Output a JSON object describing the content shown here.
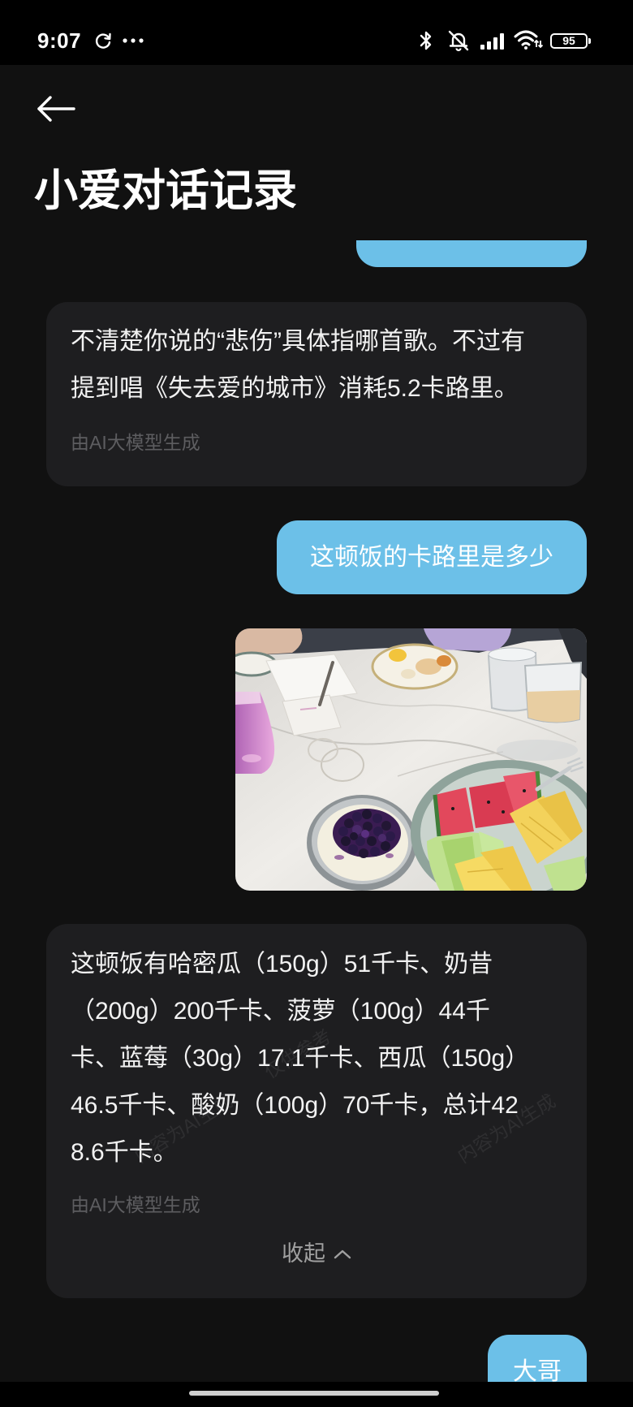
{
  "status_bar": {
    "time": "9:07",
    "battery_level": "95",
    "left_icons": [
      "sync-icon",
      "more-dots-icon"
    ],
    "right_icons": [
      "bluetooth-icon",
      "mute-icon",
      "signal-icon",
      "wifi-icon",
      "battery-icon"
    ]
  },
  "header": {
    "back_icon": "back-arrow-icon",
    "title": "小爱对话记录"
  },
  "conversation": {
    "assistant_reply_1": {
      "lines": [
        "不清楚你说的“悲伤”具体指哪首歌。不过有",
        "提到唱《失去爱的城市》消耗5.2卡路里。"
      ],
      "footnote": "由AI大模型生成"
    },
    "user_message_1": {
      "text": "这顿饭的卡路里是多少"
    },
    "assistant_reply_2": {
      "lines": [
        "这顿饭有哈密瓜（150g）51千卡、奶昔",
        "（200g）200千卡、菠萝（100g）44千",
        "卡、蓝莓（30g）17.1千卡、西瓜（150g）",
        "46.5千卡、酸奶（100g）70千卡，总计42",
        "8.6千卡。"
      ],
      "footnote": "由AI大模型生成",
      "collapse_label": "收起",
      "collapse_icon": "chevron-up-icon",
      "watermarks": [
        "内容为AI生成",
        "仅供参考",
        "内容为AI生成"
      ]
    },
    "user_message_2": {
      "text": "大哥"
    }
  },
  "theme": {
    "page_bg": "#111111",
    "status_bg": "#000000",
    "card_bg": "#1e1e20",
    "bubble": "#6cc0e8",
    "text": "#f2f2f2",
    "muted": "#5d5d60",
    "collapse": "#a0a0a0"
  }
}
